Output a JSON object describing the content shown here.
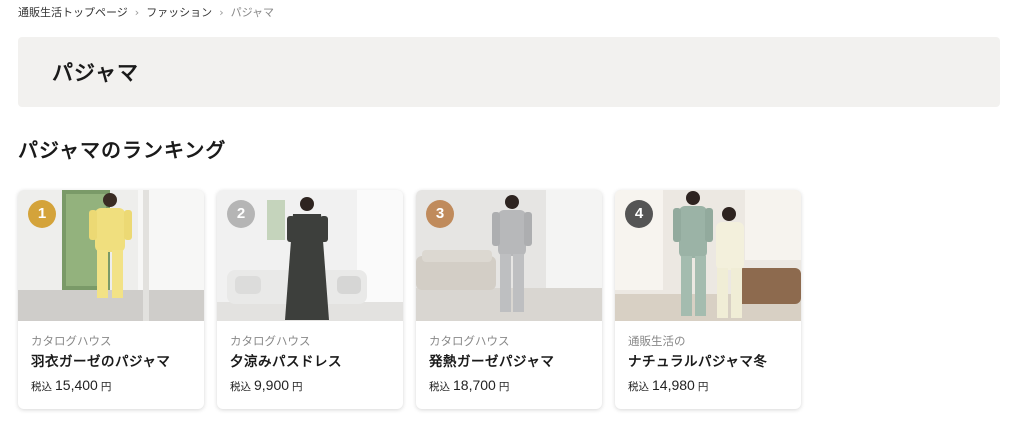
{
  "breadcrumb": [
    {
      "label": "通販生活トップページ"
    },
    {
      "label": "ファッション"
    },
    {
      "label": "パジャマ"
    }
  ],
  "page_title": "パジャマ",
  "section_heading": "パジャマのランキング",
  "colors": {
    "rank_1": "#d4a33a",
    "rank_2": "#b5b5b5",
    "rank_3": "#c08b5c",
    "rank_4": "#555555",
    "title_band_bg": "#f2f1ef"
  },
  "ranking": [
    {
      "rank": "1",
      "brand": "カタログハウス",
      "name": "羽衣ガーゼのパジャマ",
      "price_prefix": "税込",
      "price": "15,400",
      "price_unit": "円"
    },
    {
      "rank": "2",
      "brand": "カタログハウス",
      "name": "夕涼みパスドレス",
      "price_prefix": "税込",
      "price": "9,900",
      "price_unit": "円"
    },
    {
      "rank": "3",
      "brand": "カタログハウス",
      "name": "発熱ガーゼパジャマ",
      "price_prefix": "税込",
      "price": "18,700",
      "price_unit": "円"
    },
    {
      "rank": "4",
      "brand": "通販生活の",
      "name": "ナチュラルパジャマ冬",
      "price_prefix": "税込",
      "price": "14,980",
      "price_unit": "円"
    }
  ]
}
